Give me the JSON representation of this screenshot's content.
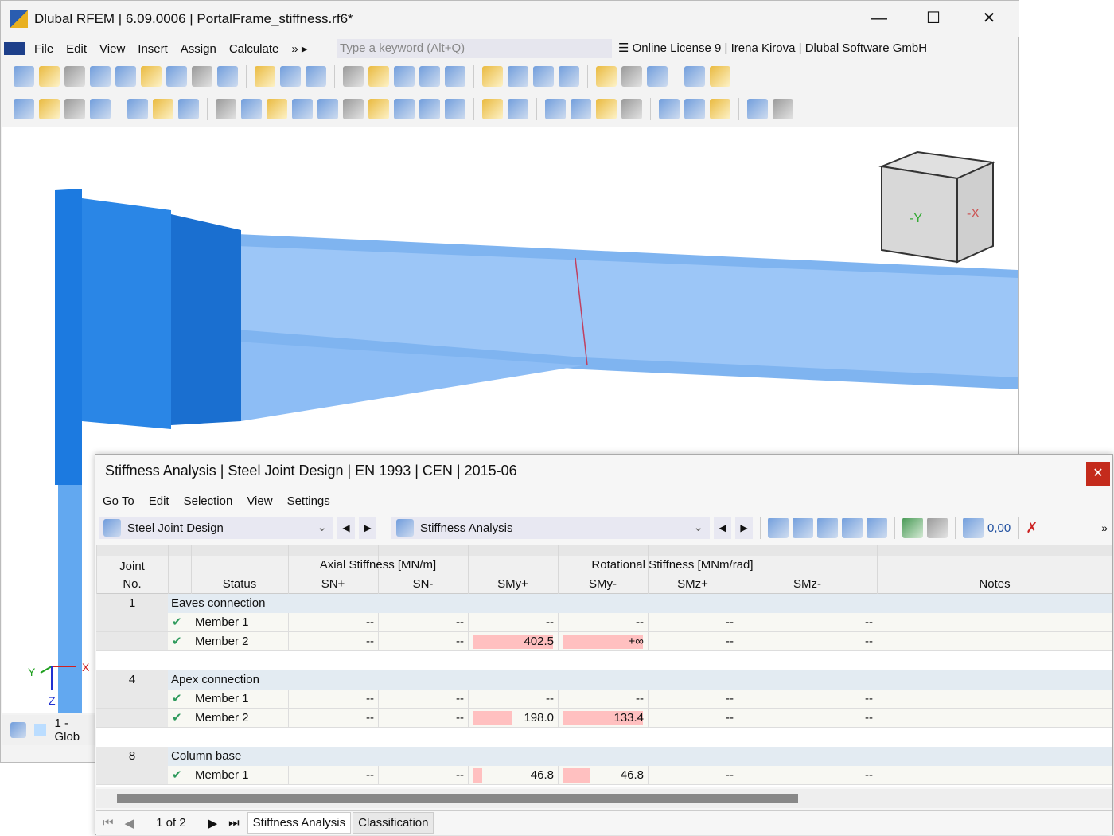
{
  "app": {
    "title": "Dlubal RFEM | 6.09.0006 | PortalFrame_stiffness.rf6*",
    "menu": [
      "File",
      "Edit",
      "View",
      "Insert",
      "Assign",
      "Calculate"
    ],
    "search_placeholder": "Type a keyword (Alt+Q)",
    "license": "Online License 9 | Irena Kirova | Dlubal Software GmbH",
    "status_item": "1 - Glob",
    "axes": {
      "x": "X",
      "y": "Y",
      "z": "Z"
    },
    "cube": {
      "neg_y": "-Y",
      "neg_x": "-X"
    }
  },
  "dialog": {
    "title": "Stiffness Analysis | Steel Joint Design | EN 1993 | CEN | 2015-06",
    "menu": [
      "Go To",
      "Edit",
      "Selection",
      "View",
      "Settings"
    ],
    "module_combo": "Steel Joint Design",
    "result_combo": "Stiffness Analysis",
    "decimal_label": "0,00",
    "headers": {
      "joint": "Joint",
      "no": "No.",
      "status": "Status",
      "axial": "Axial Stiffness [MN/m]",
      "rotational": "Rotational Stiffness [MNm/rad]",
      "sn_plus": "SN+",
      "sn_minus": "SN-",
      "smy_plus": "SMy+",
      "smy_minus": "SMy-",
      "smz_plus": "SMz+",
      "smz_minus": "SMz-",
      "notes": "Notes"
    },
    "groups": [
      {
        "no": "1",
        "name": "Eaves connection",
        "rows": [
          {
            "member": "Member 1",
            "status": "ok",
            "sn_plus": "--",
            "sn_minus": "--",
            "smy_plus": "--",
            "smy_minus": "--",
            "smz_plus": "--",
            "smz_minus": "--"
          },
          {
            "member": "Member 2",
            "status": "ok",
            "sn_plus": "--",
            "sn_minus": "--",
            "smy_plus": "402.5",
            "smy_plus_bar": 1.0,
            "smy_minus": "+∞",
            "smy_minus_bar": 1.0,
            "smz_plus": "--",
            "smz_minus": "--"
          }
        ]
      },
      {
        "no": "4",
        "name": "Apex connection",
        "rows": [
          {
            "member": "Member 1",
            "status": "ok",
            "sn_plus": "--",
            "sn_minus": "--",
            "smy_plus": "--",
            "smy_minus": "--",
            "smz_plus": "--",
            "smz_minus": "--"
          },
          {
            "member": "Member 2",
            "status": "ok",
            "sn_plus": "--",
            "sn_minus": "--",
            "smy_plus": "198.0",
            "smy_plus_bar": 0.49,
            "smy_minus": "133.4",
            "smy_minus_bar": 1.0,
            "smz_plus": "--",
            "smz_minus": "--"
          }
        ]
      },
      {
        "no": "8",
        "name": "Column base",
        "rows": [
          {
            "member": "Member 1",
            "status": "ok",
            "sn_plus": "--",
            "sn_minus": "--",
            "smy_plus": "46.8",
            "smy_plus_bar": 0.12,
            "smy_minus": "46.8",
            "smy_minus_bar": 0.35,
            "smz_plus": "--",
            "smz_minus": "--"
          }
        ]
      }
    ],
    "pager": "1 of 2",
    "tabs": [
      "Stiffness Analysis",
      "Classification"
    ],
    "bar_color": "#ffc0c0",
    "group_row_color": "#e3ebf2",
    "ok_color": "#2e9a5c"
  }
}
